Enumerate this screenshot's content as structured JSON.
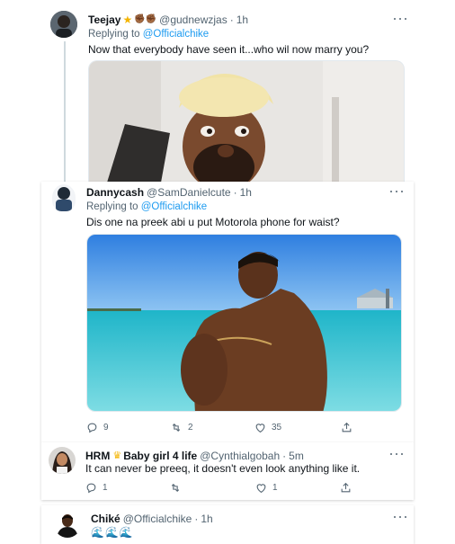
{
  "tweets": [
    {
      "name": "Teejay",
      "handle": "@gudnewzjas",
      "time": "1h",
      "replying_prefix": "Replying to ",
      "replying_to": "@Officialchike",
      "text": "Now that everybody have seen it...who wil now marry you?"
    },
    {
      "name": "Dannycash",
      "handle": "@SamDanielcute",
      "time": "1h",
      "replying_prefix": "Replying to ",
      "replying_to": "@Officialchike",
      "text": "Dis one na preek abi u put Motorola phone for waist?",
      "stats": {
        "replies": "9",
        "retweets": "2",
        "likes": "35"
      }
    },
    {
      "name": "HRM",
      "name_rest": "Baby girl 4 life",
      "handle": "@Cynthialgobah",
      "time": "5m",
      "text": "It can never be preeq, it doesn't even look anything like it.",
      "stats": {
        "replies": "1",
        "retweets": "",
        "likes": "1"
      }
    },
    {
      "name": "Chiké",
      "handle": "@Officialchike",
      "time": "1h",
      "text": "🌊🌊🌊"
    }
  ],
  "separator": "·",
  "icons": {
    "reply": "reply-icon",
    "retweet": "retweet-icon",
    "like": "like-icon",
    "share": "share-icon",
    "more": "more-icon"
  },
  "colors": {
    "accent": "#1d9bf0",
    "secondary_text": "#536471",
    "border": "#cfd9de"
  }
}
